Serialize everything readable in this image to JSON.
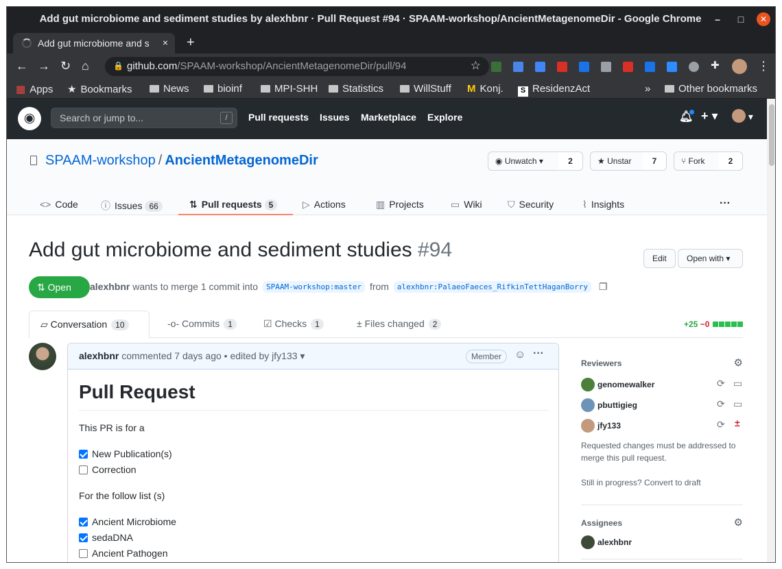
{
  "window": {
    "title": "Add gut microbiome and sediment studies by alexhbnr · Pull Request #94 · SPAAM-workshop/AncientMetagenomeDir - Google Chrome"
  },
  "tab": {
    "title": "Add gut microbiome and s",
    "close": "×"
  },
  "address": {
    "host": "github.com",
    "path": "/SPAAM-workshop/AncientMetagenomeDir/pull/94"
  },
  "bookmarks": {
    "apps": "Apps",
    "bookmarks": "Bookmarks",
    "news": "News",
    "bioinf": "bioinf",
    "mpi": "MPI-SHH",
    "statistics": "Statistics",
    "willstuff": "WillStuff",
    "konj": "Konj.",
    "residenz": "ResidenzAct",
    "more": "»",
    "other": "Other bookmarks"
  },
  "github_header": {
    "search_placeholder": "Search or jump to...",
    "search_key": "/",
    "nav": [
      "Pull requests",
      "Issues",
      "Marketplace",
      "Explore"
    ]
  },
  "repo": {
    "owner": "SPAAM-workshop",
    "name": "AncientMetagenomeDir",
    "unwatch_label": "Unwatch",
    "watch_count": "2",
    "unstar_label": "Unstar",
    "star_count": "7",
    "fork_label": "Fork",
    "fork_count": "2",
    "tabs": {
      "code": "Code",
      "issues": "Issues",
      "issues_count": "66",
      "pulls": "Pull requests",
      "pulls_count": "5",
      "actions": "Actions",
      "projects": "Projects",
      "wiki": "Wiki",
      "security": "Security",
      "insights": "Insights",
      "more": "···"
    }
  },
  "pr": {
    "title": "Add gut microbiome and sediment studies",
    "number": "#94",
    "edit": "Edit",
    "open_with": "Open with",
    "state": "Open",
    "author": "alexhbnr",
    "meta_text": "wants to merge 1 commit into",
    "base": "SPAAM-workshop:master",
    "from": "from",
    "head": "alexhbnr:PalaeoFaeces_RifkinTettHaganBorry",
    "tabs": {
      "conversation": "Conversation",
      "conversation_count": "10",
      "commits": "Commits",
      "commits_count": "1",
      "checks": "Checks",
      "checks_count": "1",
      "files": "Files changed",
      "files_count": "2"
    },
    "additions": "+25",
    "deletions": "−0"
  },
  "comment": {
    "author": "alexhbnr",
    "time": "commented 7 days ago • edited by",
    "editor": "jfy133",
    "badge": "Member",
    "heading": "Pull Request",
    "intro": "This PR is for a",
    "type_items": [
      {
        "label": "New Publication(s)",
        "checked": true
      },
      {
        "label": "Correction",
        "checked": false
      }
    ],
    "list_intro": "For the follow list (s)",
    "list_items": [
      {
        "label": "Ancient Microbiome",
        "checked": true
      },
      {
        "label": "sedaDNA",
        "checked": true
      },
      {
        "label": "Ancient Pathogen",
        "checked": false
      }
    ]
  },
  "sidebar": {
    "reviewers_title": "Reviewers",
    "reviewers": [
      "genomewalker",
      "pbuttigieg",
      "jfy133"
    ],
    "requested_note": "Requested changes must be addressed to merge this pull request.",
    "draft_note": "Still in progress? Convert to draft",
    "assignees_title": "Assignees",
    "assignees": [
      "alexhbnr"
    ]
  },
  "colors": {
    "accent": "#0366d6",
    "open_green": "#28a745",
    "tab_underline": "#f9826c",
    "chrome_dark": "#202124"
  }
}
